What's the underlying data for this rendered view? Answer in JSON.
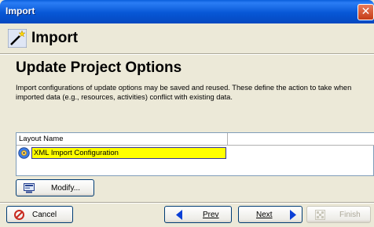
{
  "window": {
    "title": "Import",
    "close_glyph": "✕"
  },
  "header": {
    "title": "Import",
    "icon": "wand-icon"
  },
  "content": {
    "title": "Update Project Options",
    "description": "Import configurations of update options may be saved and reused.  These define the action to take when imported data (e.g., resources, activities) conflict with existing data."
  },
  "table": {
    "columns": [
      "Layout Name"
    ],
    "rows": [
      {
        "label": "XML Import Configuration",
        "icon": "configuration-icon",
        "selected": true
      }
    ],
    "selected_bg": "#ffff00"
  },
  "buttons": {
    "modify": "Modify...",
    "cancel": "Cancel",
    "prev": "Prev",
    "next": "Next",
    "finish": "Finish"
  },
  "colors": {
    "titlebar": "#0757d6",
    "dialog_bg": "#ece9d8",
    "nav_arrow": "#0b3fd6",
    "cancel_icon": "#c8281e"
  }
}
